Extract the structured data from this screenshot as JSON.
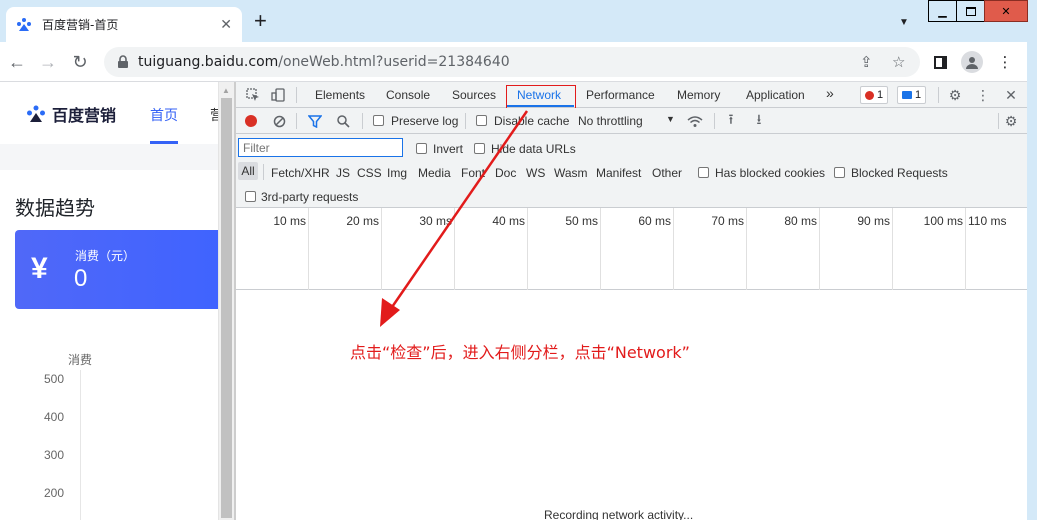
{
  "browser": {
    "tab_title": "百度营销-首页",
    "tab_close": "✕",
    "new_tab": "+",
    "url_host": "tuiguang.baidu.com",
    "url_path": "/oneWeb.html?userid=21384640",
    "window_min": "▁",
    "window_max": "▫",
    "window_close": "✕",
    "icons": [
      "back-icon",
      "forward-icon",
      "reload-icon",
      "lock-icon",
      "share-icon",
      "star-icon",
      "sidepanel-icon",
      "profile-icon",
      "menu-icon"
    ]
  },
  "page": {
    "logo_text": "百度营销",
    "nav_home": "首页",
    "nav_next": "营",
    "section_title": "数据趋势",
    "card_label": "消费（元）",
    "card_value": "0",
    "card_symbol": "¥",
    "chart_y_title": "消费",
    "y_ticks": [
      "500",
      "400",
      "300",
      "200"
    ]
  },
  "devtools": {
    "tabs": [
      "Elements",
      "Console",
      "Sources",
      "Network",
      "Performance",
      "Memory",
      "Application"
    ],
    "active_tab": "Network",
    "more_tabs": "»",
    "error_count": "1",
    "message_count": "1",
    "preserve_log": "Preserve log",
    "disable_cache": "Disable cache",
    "throttling": "No throttling",
    "filter_placeholder": "Filter",
    "invert": "Invert",
    "hide_data_urls": "Hide data URLs",
    "type_filters": [
      "All",
      "Fetch/XHR",
      "JS",
      "CSS",
      "Img",
      "Media",
      "Font",
      "Doc",
      "WS",
      "Wasm",
      "Manifest",
      "Other"
    ],
    "has_blocked_cookies": "Has blocked cookies",
    "blocked_requests": "Blocked Requests",
    "third_party": "3rd-party requests",
    "timeline_labels": [
      "10 ms",
      "20 ms",
      "30 ms",
      "40 ms",
      "50 ms",
      "60 ms",
      "70 ms",
      "80 ms",
      "90 ms",
      "100 ms",
      "110 ms"
    ],
    "recording_text": "Recording network activity..."
  },
  "annotation": {
    "text": "点击“检查”后，进入右侧分栏，点击“Network”",
    "color": "#e21b1b"
  },
  "colors": {
    "accent_blue": "#1a73e8",
    "brand_blue": "#3562f6",
    "record_red": "#d93025"
  }
}
